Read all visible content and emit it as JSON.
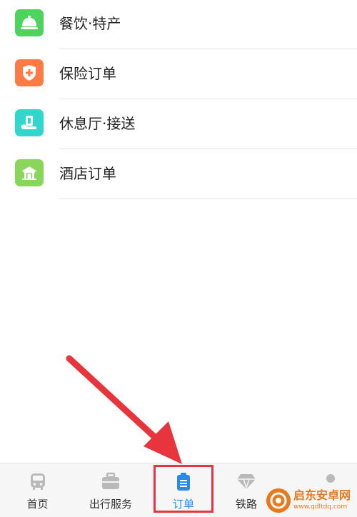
{
  "menu": {
    "items": [
      {
        "label": "餐饮·特产",
        "icon": "bell-icon",
        "color": "#4cd45c"
      },
      {
        "label": "保险订单",
        "icon": "shield-icon",
        "color": "#ff7a45"
      },
      {
        "label": "休息厅·接送",
        "icon": "lounge-icon",
        "color": "#33d6cc"
      },
      {
        "label": "酒店订单",
        "icon": "hotel-icon",
        "color": "#8ad65a"
      }
    ]
  },
  "tabbar": {
    "tabs": [
      {
        "label": "首页",
        "icon": "train-icon"
      },
      {
        "label": "出行服务",
        "icon": "briefcase-icon"
      },
      {
        "label": "订单",
        "icon": "order-clipboard-icon",
        "active": true
      },
      {
        "label": "铁路",
        "icon": "diamond-icon"
      }
    ],
    "active_color": "#2b8ae8"
  },
  "annotation": {
    "color": "#e8343c"
  },
  "watermark": {
    "title": "启东安卓网",
    "url": "www.qdltdq.com",
    "color": "#e87a1e"
  }
}
